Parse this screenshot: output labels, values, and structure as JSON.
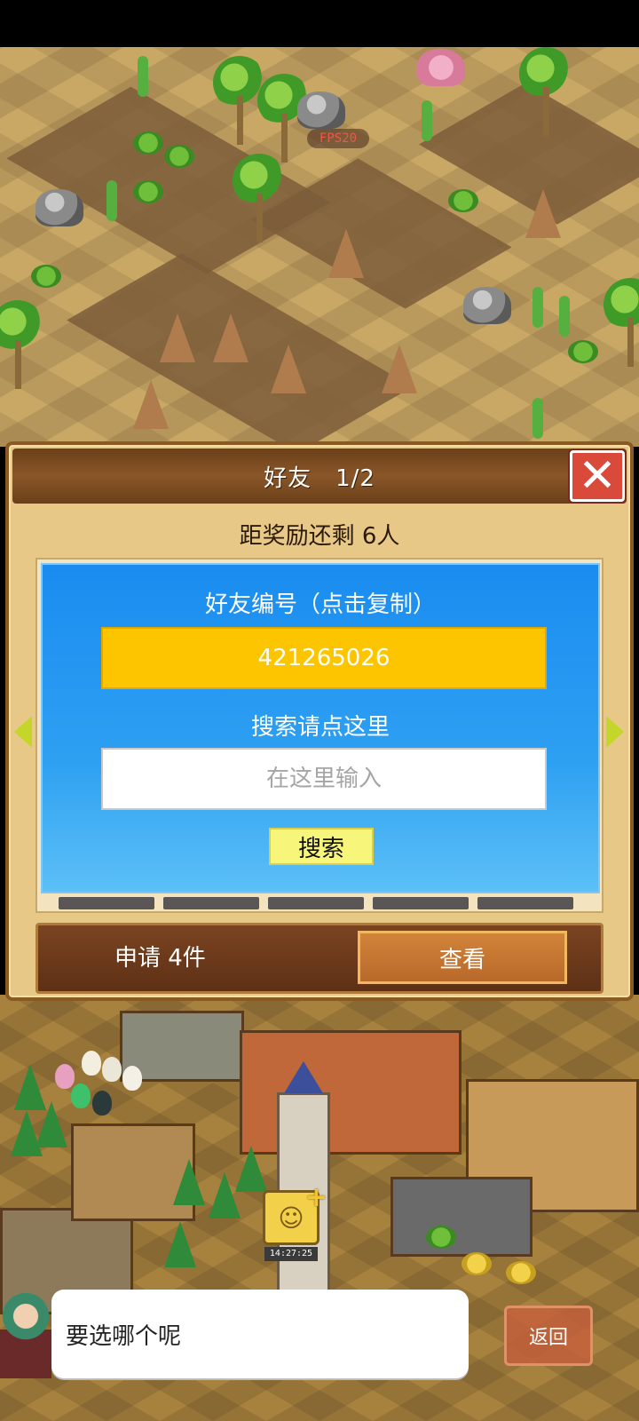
{
  "hud": {
    "fps_label": "FPS20",
    "timer": "14:27:25"
  },
  "dialog": {
    "title": "好友　1/2",
    "reward_text": "距奖励还剩 6人",
    "friend_id_caption": "好友编号（点击复制）",
    "friend_id": "421265026",
    "search_caption": "搜索请点这里",
    "search_placeholder": "在这里输入",
    "search_button": "搜索",
    "requests_label": "申请 4件",
    "view_button": "查看"
  },
  "footer": {
    "speech": "要选哪个呢",
    "back_button": "返回"
  },
  "icons": {
    "close": "close-icon",
    "prev": "chevron-left-icon",
    "next": "chevron-right-icon",
    "friends": "friends-add-icon"
  },
  "colors": {
    "header_brown": "#8a5629",
    "panel_blue": "#1a8cf0",
    "code_yellow": "#fdc500",
    "search_button": "#f7f57a",
    "close_red": "#d94a3b",
    "view_button": "#c27631"
  }
}
